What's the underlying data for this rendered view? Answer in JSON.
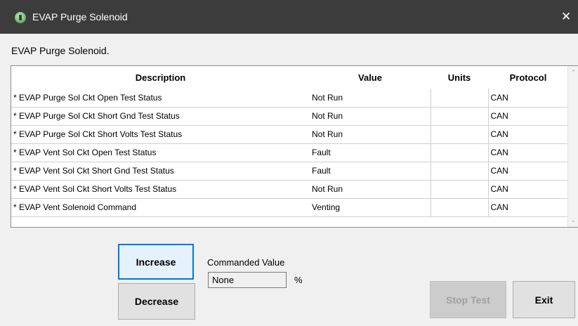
{
  "window": {
    "title": "EVAP Purge Solenoid",
    "close_glyph": "✕"
  },
  "subtitle": "EVAP Purge Solenoid.",
  "table": {
    "headers": {
      "description": "Description",
      "value": "Value",
      "units": "Units",
      "protocol": "Protocol"
    },
    "rows": [
      {
        "description": "* EVAP Purge Sol Ckt Open Test Status",
        "value": "Not Run",
        "units": "",
        "protocol": "CAN"
      },
      {
        "description": "* EVAP Purge Sol Ckt Short Gnd Test Status",
        "value": "Not Run",
        "units": "",
        "protocol": "CAN"
      },
      {
        "description": "* EVAP Purge Sol Ckt Short Volts Test Status",
        "value": "Not Run",
        "units": "",
        "protocol": "CAN"
      },
      {
        "description": "* EVAP Vent Sol Ckt Open Test Status",
        "value": "Fault",
        "units": "",
        "protocol": "CAN"
      },
      {
        "description": "* EVAP Vent Sol Ckt Short Gnd Test Status",
        "value": "Fault",
        "units": "",
        "protocol": "CAN"
      },
      {
        "description": "* EVAP Vent Sol Ckt Short Volts Test Status",
        "value": "Not Run",
        "units": "",
        "protocol": "CAN"
      },
      {
        "description": "* EVAP Vent Solenoid Command",
        "value": "Venting",
        "units": "",
        "protocol": "CAN"
      }
    ]
  },
  "controls": {
    "increase_label": "Increase",
    "decrease_label": "Decrease",
    "commanded_value_label": "Commanded Value",
    "commanded_value": "None",
    "commanded_unit": "%",
    "stop_test_label": "Stop Test",
    "exit_label": "Exit"
  },
  "icons": {
    "app_icon": "app-icon",
    "scroll_up": "chevron-up-icon",
    "scroll_down": "chevron-down-icon"
  },
  "colors": {
    "titlebar": "#3c3c3c",
    "focus_border": "#0078d7"
  }
}
